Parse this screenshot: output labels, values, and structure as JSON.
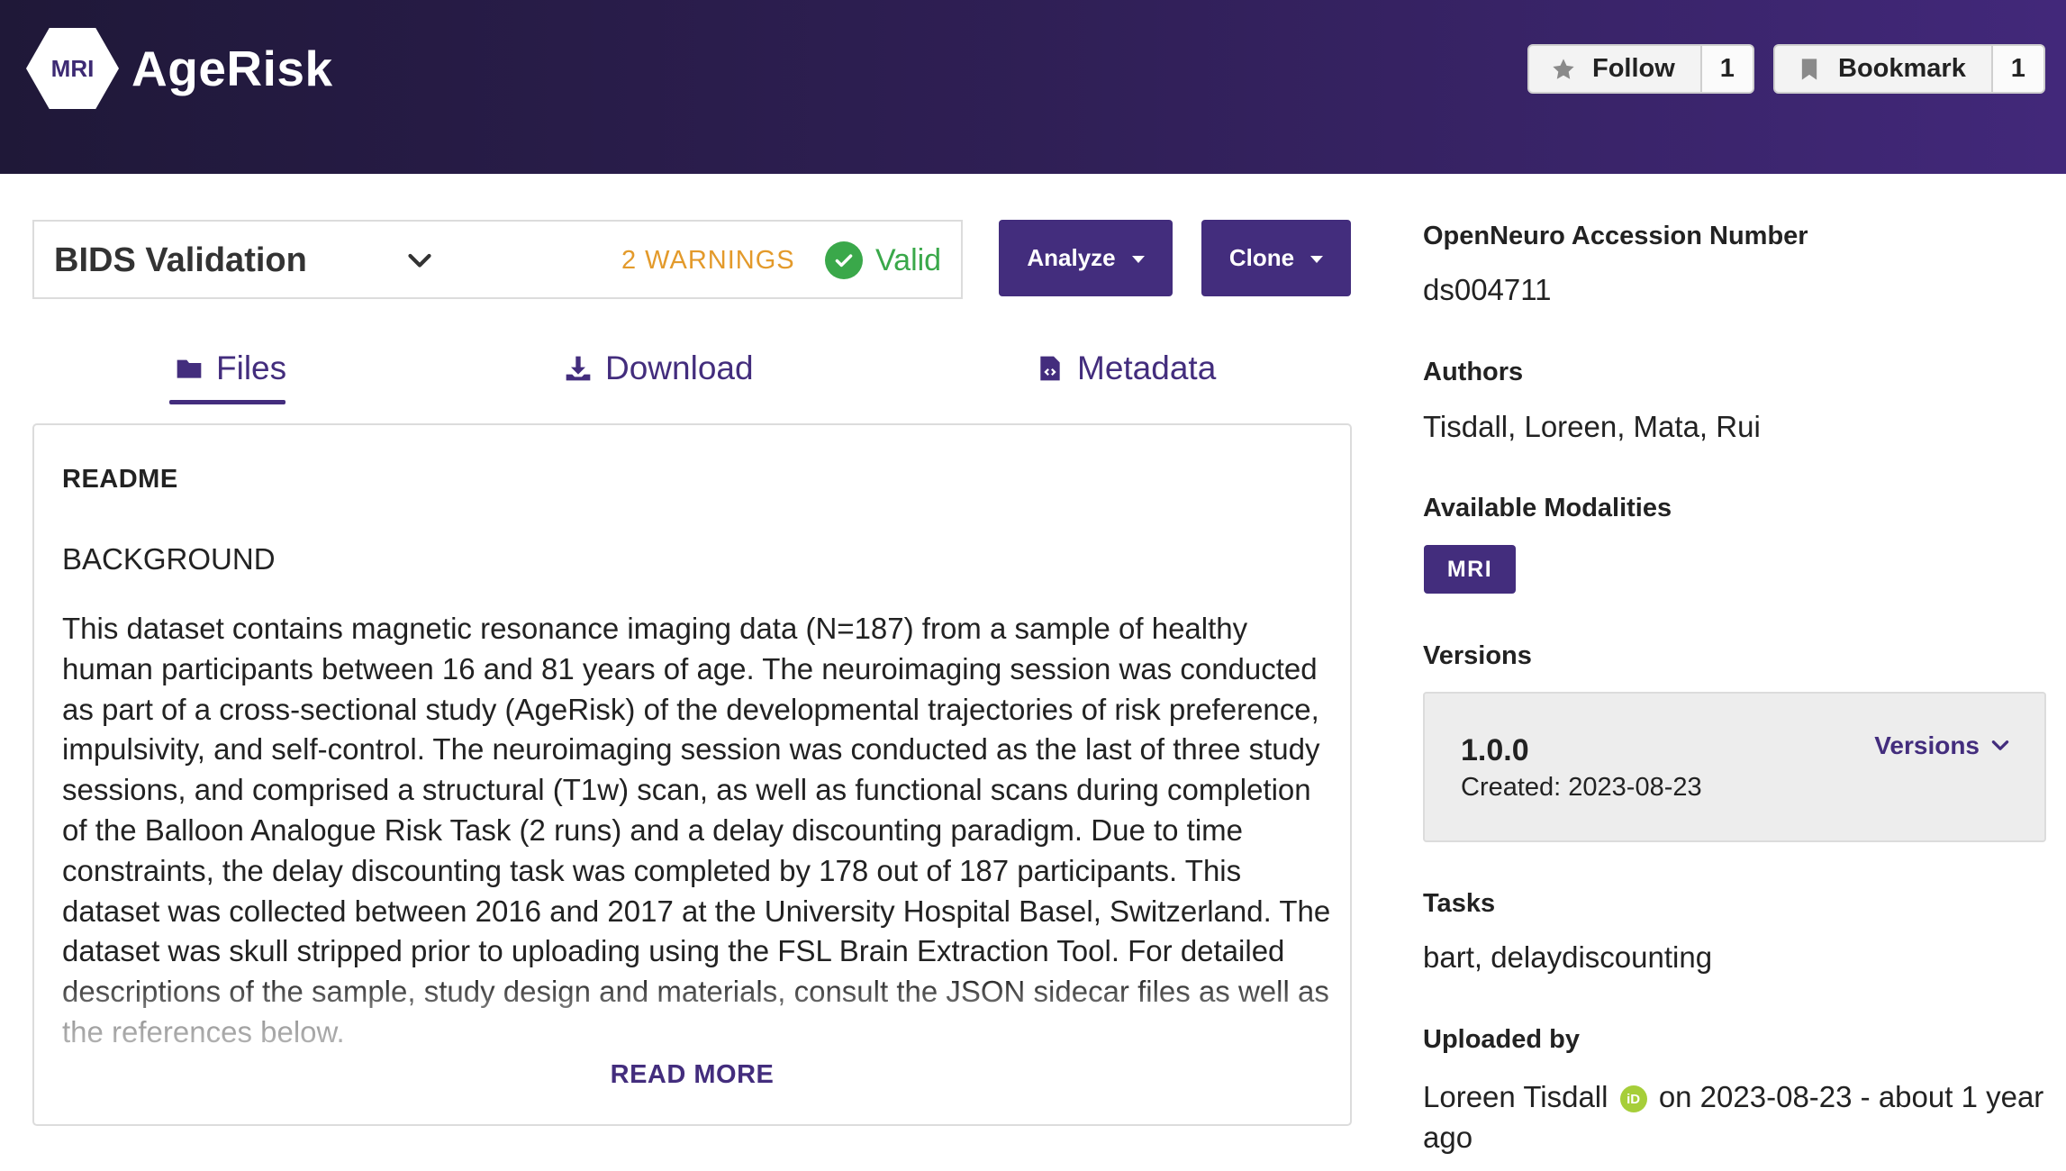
{
  "header": {
    "logo_text": "MRI",
    "site_title": "AgeRisk",
    "follow": {
      "label": "Follow",
      "count": "1"
    },
    "bookmark": {
      "label": "Bookmark",
      "count": "1"
    }
  },
  "validation": {
    "title": "BIDS Validation",
    "warnings": "2 WARNINGS",
    "status": "Valid"
  },
  "actions": {
    "analyze": "Analyze",
    "clone": "Clone"
  },
  "tabs": [
    {
      "label": "Files",
      "icon": "folder-icon",
      "active": true
    },
    {
      "label": "Download",
      "icon": "download-icon",
      "active": false
    },
    {
      "label": "Metadata",
      "icon": "file-code-icon",
      "active": false
    }
  ],
  "readme": {
    "title": "README",
    "heading": "BACKGROUND",
    "body": "This dataset contains magnetic resonance imaging data (N=187) from a sample of healthy human participants between 16 and 81 years of age. The neuroimaging session was conducted as part of a cross-sectional study (AgeRisk) of the developmental trajectories of risk preference, impulsivity, and self-control. The neuroimaging session was conducted as the last of three study sessions, and comprised a structural (T1w) scan, as well as functional scans during completion of the Balloon Analogue Risk Task (2 runs) and a delay discounting paradigm. Due to time constraints, the delay discounting task was completed by 178 out of 187 participants. This dataset was collected between 2016 and 2017 at the University Hospital Basel, Switzerland. The dataset was skull stripped prior to uploading using the FSL Brain Extraction Tool. For detailed descriptions of the sample, study design and materials, consult the JSON sidecar files as well as the references below.",
    "read_more": "READ MORE"
  },
  "sidebar": {
    "accession_label": "OpenNeuro Accession Number",
    "accession_value": "ds004711",
    "authors_label": "Authors",
    "authors_value": "Tisdall, Loreen, Mata, Rui",
    "modalities_label": "Available Modalities",
    "modality": "MRI",
    "versions_label": "Versions",
    "version": "1.0.0",
    "version_created": "Created: 2023-08-23",
    "versions_link": "Versions",
    "tasks_label": "Tasks",
    "tasks_value": "bart, delaydiscounting",
    "uploaded_label": "Uploaded by",
    "uploader": "Loreen Tisdall",
    "orcid_badge": "iD",
    "uploaded_when_line1": "on 2023-08-23 - about 1 year",
    "uploaded_when_line2": "ago"
  },
  "colors": {
    "brand_purple": "#432d7d",
    "warning": "#e39a2b",
    "valid_green": "#3aa84a",
    "orcid_green": "#a6ce39"
  }
}
